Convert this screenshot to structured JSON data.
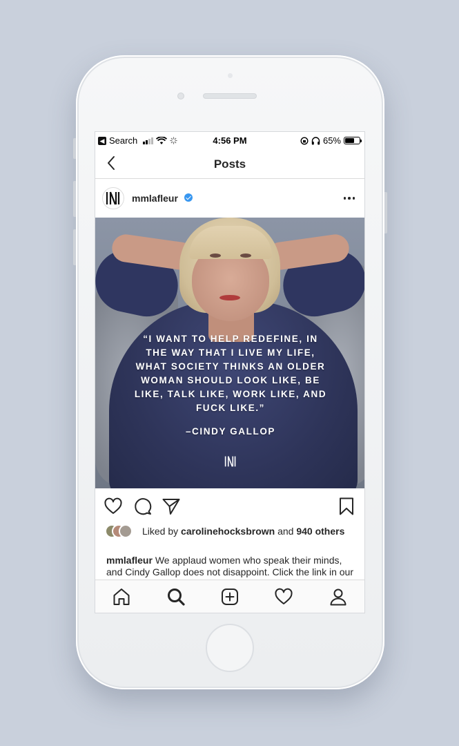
{
  "status_bar": {
    "back_app": "Search",
    "time": "4:56 PM",
    "battery": "65%",
    "battery_level": 0.65
  },
  "nav": {
    "title": "Posts",
    "back_icon": "chevron-left-icon"
  },
  "post": {
    "username": "mmlafleur",
    "verified": true,
    "more_icon": "more-dots-icon",
    "image": {
      "quote": "“I WANT TO HELP REDEFINE, IN\nTHE WAY THAT I LIVE MY LIFE,\nWHAT SOCIETY THINKS AN OLDER\nWOMAN SHOULD LOOK LIKE, BE\nLIKE, TALK LIKE, WORK LIKE, AND\nFUCK LIKE.”",
      "attribution": "–CINDY GALLOP"
    },
    "actions": {
      "like_icon": "heart-icon",
      "comment_icon": "comment-icon",
      "share_icon": "send-icon",
      "save_icon": "bookmark-icon"
    },
    "likes": {
      "prefix": "Liked by",
      "user": "carolinehocksbrown",
      "middle": "and",
      "count": "940",
      "suffix": "others"
    },
    "caption": {
      "username": "mmlafleur",
      "text": "We applaud women who speak their minds, and Cindy Gallop does not disappoint. Click the link in our profile to read why she made"
    }
  },
  "tabbar": {
    "home_icon": "home-icon",
    "search_icon": "search-icon",
    "add_icon": "add-post-icon",
    "activity_icon": "heart-icon",
    "profile_icon": "profile-icon"
  },
  "colors": {
    "background": "#c9d0dc",
    "verified": "#3897f0",
    "text": "#262626",
    "divider": "#dbdbdb"
  }
}
